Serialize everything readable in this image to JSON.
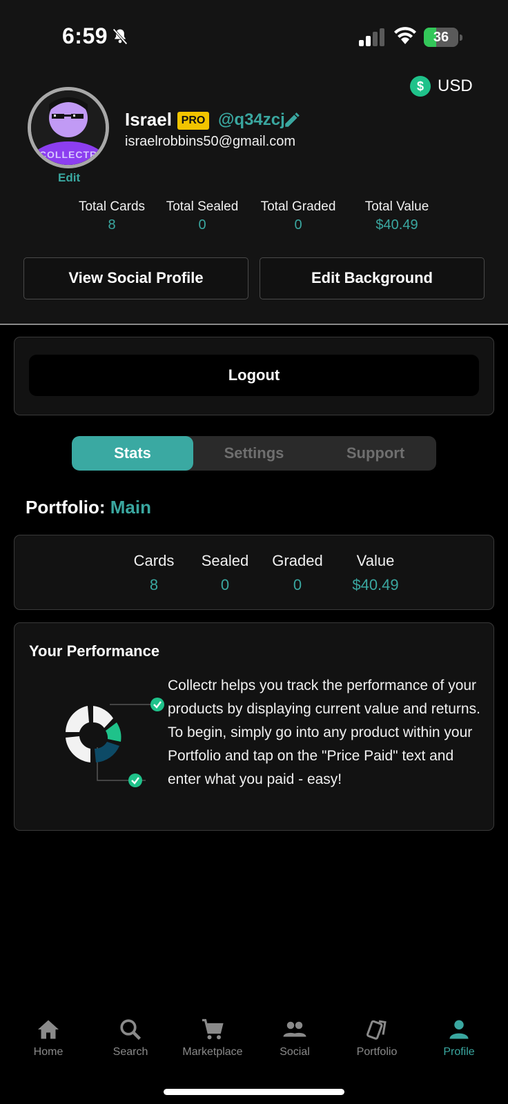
{
  "status_bar": {
    "time": "6:59",
    "battery": "36",
    "battery_level": 0.36
  },
  "currency": {
    "symbol": "$",
    "label": "USD"
  },
  "profile": {
    "avatar_text": "COLLECTR",
    "edit_label": "Edit",
    "name": "Israel",
    "badge": "PRO",
    "handle": "@q34zcj",
    "email": "israelrobbins50@gmail.com"
  },
  "totals": [
    {
      "label": "Total Cards",
      "value": "8"
    },
    {
      "label": "Total Sealed",
      "value": "0"
    },
    {
      "label": "Total Graded",
      "value": "0"
    },
    {
      "label": "Total Value",
      "value": "$40.49"
    }
  ],
  "buttons": {
    "view_social": "View Social Profile",
    "edit_background": "Edit Background",
    "logout": "Logout"
  },
  "tabs": [
    {
      "label": "Stats",
      "active": true
    },
    {
      "label": "Settings",
      "active": false
    },
    {
      "label": "Support",
      "active": false
    }
  ],
  "portfolio": {
    "prefix": "Portfolio: ",
    "name": "Main",
    "stats": [
      {
        "label": "Cards",
        "value": "8"
      },
      {
        "label": "Sealed",
        "value": "0"
      },
      {
        "label": "Graded",
        "value": "0"
      },
      {
        "label": "Value",
        "value": "$40.49"
      }
    ]
  },
  "performance": {
    "title": "Your Performance",
    "text": "Collectr helps you track the performance of your products by displaying current value and returns.  To begin, simply go into any product within your Portfolio and tap on the \"Price Paid\" text and enter what you paid - easy!"
  },
  "nav": [
    {
      "label": "Home",
      "icon": "home-icon",
      "active": false
    },
    {
      "label": "Search",
      "icon": "search-icon",
      "active": false
    },
    {
      "label": "Marketplace",
      "icon": "cart-icon",
      "active": false
    },
    {
      "label": "Social",
      "icon": "people-icon",
      "active": false
    },
    {
      "label": "Portfolio",
      "icon": "cards-icon",
      "active": false
    },
    {
      "label": "Profile",
      "icon": "person-icon",
      "active": true
    }
  ],
  "colors": {
    "accent": "#3aa7a0",
    "pro": "#f2c400",
    "currency": "#1fc28a",
    "battery": "#33c759"
  }
}
